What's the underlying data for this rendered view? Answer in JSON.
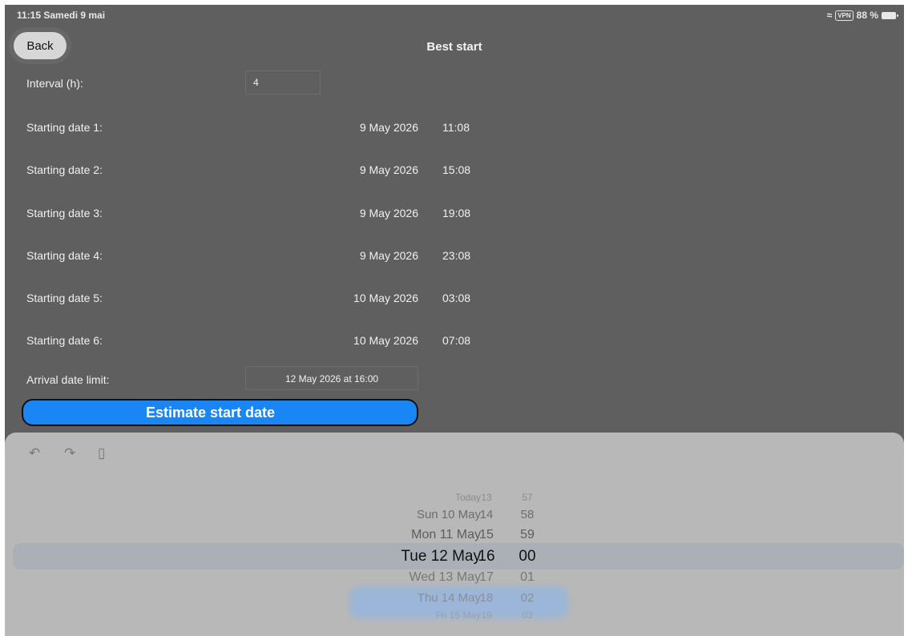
{
  "status_bar": {
    "time_date": "11:15  Samedi 9 mai",
    "vpn": "VPN",
    "battery": "88 %"
  },
  "nav": {
    "back_label": "Back",
    "title": "Best start"
  },
  "interval": {
    "label": "Interval (h):",
    "value": "4"
  },
  "starting_dates": [
    {
      "label": "Starting date 1:",
      "date": "9 May 2026",
      "time": "11:08"
    },
    {
      "label": "Starting date 2:",
      "date": "9 May 2026",
      "time": "15:08"
    },
    {
      "label": "Starting date 3:",
      "date": "9 May 2026",
      "time": "19:08"
    },
    {
      "label": "Starting date 4:",
      "date": "9 May 2026",
      "time": "23:08"
    },
    {
      "label": "Starting date 5:",
      "date": "10 May 2026",
      "time": "03:08"
    },
    {
      "label": "Starting date 6:",
      "date": "10 May 2026",
      "time": "07:08"
    }
  ],
  "arrival": {
    "label": "Arrival date limit:",
    "value": "12 May 2026 at 16:00"
  },
  "estimate_button": "Estimate start date",
  "toolbar": {
    "undo_icon": "↶",
    "redo_icon": "↷",
    "paste_icon": "▯"
  },
  "picker": {
    "rows": [
      {
        "day": "Today",
        "hour": "13",
        "minute": "57"
      },
      {
        "day": "Sun 10 May",
        "hour": "14",
        "minute": "58"
      },
      {
        "day": "Mon 11 May",
        "hour": "15",
        "minute": "59"
      },
      {
        "day": "Tue 12 May",
        "hour": "16",
        "minute": "00"
      },
      {
        "day": "Wed 13 May",
        "hour": "17",
        "minute": "01"
      },
      {
        "day": "Thu 14 May",
        "hour": "18",
        "minute": "02"
      },
      {
        "day": "Fri 15 May",
        "hour": "19",
        "minute": "03"
      }
    ],
    "selected_index": 3
  },
  "colors": {
    "background": "#5f5f5f",
    "accent": "#1a86f5",
    "sheet": "#b8b8b8"
  }
}
